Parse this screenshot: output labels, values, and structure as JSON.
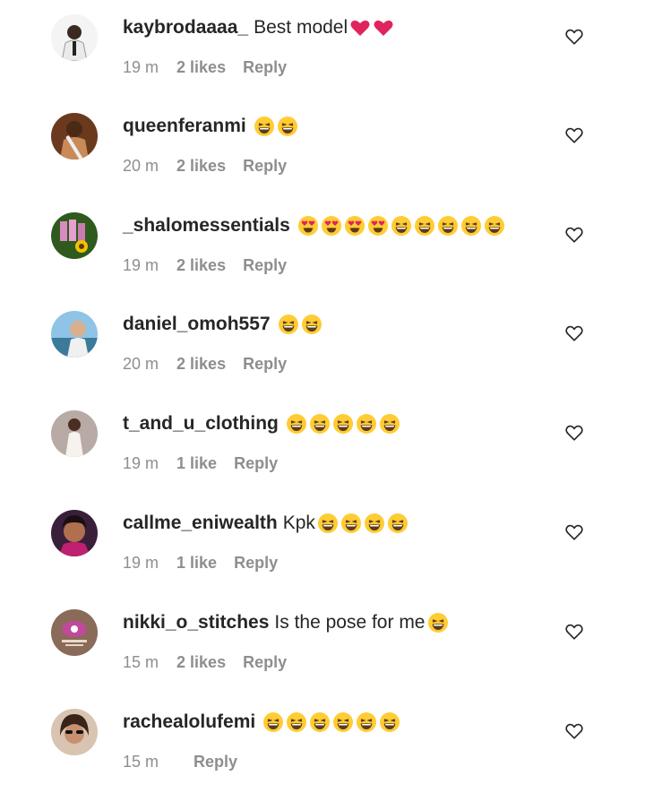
{
  "comments": [
    {
      "username": "kaybrodaaaa_",
      "text": "Best model",
      "emojis": [
        "red-heart",
        "red-heart"
      ],
      "time": "19 m",
      "likes": "2 likes",
      "reply": "Reply",
      "avatar": "avatar-person-white-top"
    },
    {
      "username": "queenferanmi",
      "text": "",
      "emojis": [
        "laughing",
        "laughing"
      ],
      "time": "20 m",
      "likes": "2 likes",
      "reply": "Reply",
      "avatar": "avatar-person-sash"
    },
    {
      "username": "_shalomessentials",
      "text": "",
      "emojis": [
        "heart-eyes",
        "heart-eyes",
        "heart-eyes",
        "heart-eyes",
        "laughing",
        "laughing",
        "laughing",
        "laughing",
        "laughing"
      ],
      "time": "19 m",
      "likes": "2 likes",
      "reply": "Reply",
      "avatar": "avatar-products-sunflower"
    },
    {
      "username": "daniel_omoh557",
      "text": "",
      "emojis": [
        "laughing",
        "laughing"
      ],
      "time": "20 m",
      "likes": "2 likes",
      "reply": "Reply",
      "avatar": "avatar-person-beach"
    },
    {
      "username": "t_and_u_clothing",
      "text": "",
      "emojis": [
        "laughing",
        "laughing",
        "laughing",
        "laughing",
        "laughing"
      ],
      "time": "19 m",
      "likes": "1 like",
      "reply": "Reply",
      "avatar": "avatar-person-white-dress"
    },
    {
      "username": "callme_eniwealth",
      "text": "Kpk",
      "emojis": [
        "laughing",
        "laughing",
        "laughing",
        "laughing"
      ],
      "time": "19 m",
      "likes": "1 like",
      "reply": "Reply",
      "avatar": "avatar-person-closeup"
    },
    {
      "username": "nikki_o_stitches",
      "text": "Is the pose for me",
      "emojis": [
        "laughing"
      ],
      "time": "15 m",
      "likes": "2 likes",
      "reply": "Reply",
      "avatar": "avatar-logo"
    },
    {
      "username": "rachealolufemi",
      "text": "",
      "emojis": [
        "laughing",
        "laughing",
        "laughing",
        "laughing",
        "laughing",
        "laughing"
      ],
      "time": "15 m",
      "likes": "",
      "reply": "Reply",
      "avatar": "avatar-person-sunglasses"
    }
  ],
  "icons": {
    "like": "heart-outline-icon"
  },
  "colors": {
    "text": "#262626",
    "meta": "#8e8e8e",
    "heart": "#e0245e",
    "emoji": "#ffcc33"
  }
}
